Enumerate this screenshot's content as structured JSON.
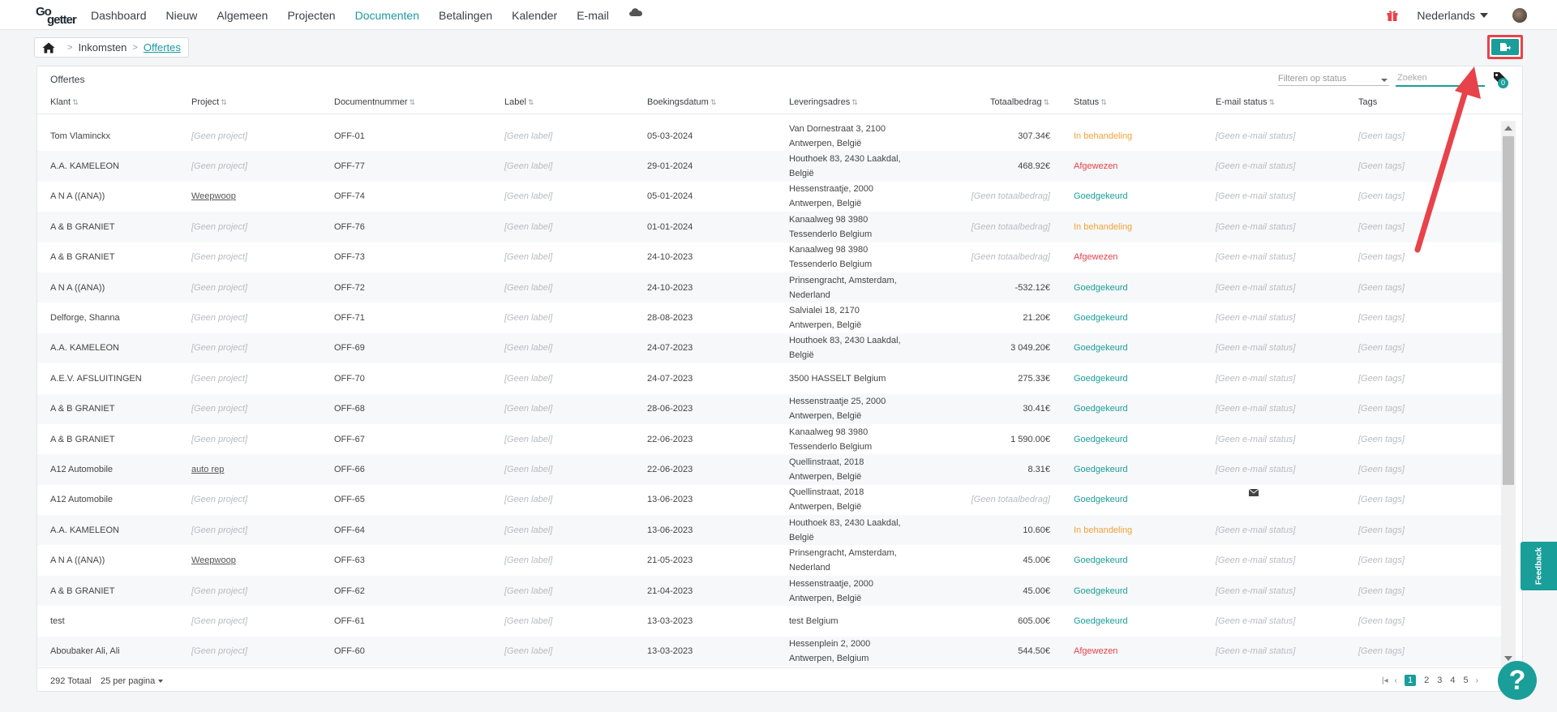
{
  "nav": {
    "logo_top": "Go",
    "logo_bottom": "getter",
    "items": [
      "Dashboard",
      "Nieuw",
      "Algemeen",
      "Projecten",
      "Documenten",
      "Betalingen",
      "Kalender",
      "E-mail"
    ],
    "active": "Documenten",
    "language": "Nederlands",
    "icons": [
      "cloud-icon",
      "gift-icon",
      "avatar"
    ]
  },
  "breadcrumb": {
    "level1": "Inkomsten",
    "level2": "Offertes",
    "icons": [
      "home-icon"
    ]
  },
  "panel": {
    "title": "Offertes",
    "status_filter": "Filteren op status",
    "search_placeholder": "Zoeken",
    "tag_badge": "0"
  },
  "columns": [
    "Klant",
    "Project",
    "Documentnummer",
    "Label",
    "Boekingsdatum",
    "Leveringsadres",
    "Totaalbedrag",
    "Status",
    "E-mail status",
    "Tags"
  ],
  "rows": [
    {
      "klant": "Tom Vlaminckx",
      "project": "[Geen project]",
      "doc": "OFF-01",
      "label": "[Geen label]",
      "date": "05-03-2024",
      "addr1": "Van Dornestraat 3, 2100",
      "addr2": "Antwerpen, België",
      "amount": "307.34€",
      "status": "In behandeling",
      "status_type": "pending",
      "email": "[Geen e-mail status]",
      "tags": "[Geen tags]"
    },
    {
      "klant": "A.A. KAMELEON",
      "project": "[Geen project]",
      "doc": "OFF-77",
      "label": "[Geen label]",
      "date": "29-01-2024",
      "addr1": "Houthoek 83, 2430 Laakdal,",
      "addr2": "België",
      "amount": "468.92€",
      "status": "Afgewezen",
      "status_type": "rejected",
      "email": "[Geen e-mail status]",
      "tags": "[Geen tags]"
    },
    {
      "klant": "A N A ((ANA))",
      "project": "Weepwoop",
      "doc": "OFF-74",
      "label": "[Geen label]",
      "date": "05-01-2024",
      "addr1": "Hessenstraatje, 2000",
      "addr2": "Antwerpen, België",
      "amount": "[Geen totaalbedrag]",
      "status": "Goedgekeurd",
      "status_type": "approved",
      "email": "[Geen e-mail status]",
      "tags": "[Geen tags]"
    },
    {
      "klant": "A & B GRANIET",
      "project": "[Geen project]",
      "doc": "OFF-76",
      "label": "[Geen label]",
      "date": "01-01-2024",
      "addr1": "Kanaalweg 98 3980",
      "addr2": "Tessenderlo Belgium",
      "amount": "[Geen totaalbedrag]",
      "status": "In behandeling",
      "status_type": "pending",
      "email": "[Geen e-mail status]",
      "tags": "[Geen tags]"
    },
    {
      "klant": "A & B GRANIET",
      "project": "[Geen project]",
      "doc": "OFF-73",
      "label": "[Geen label]",
      "date": "24-10-2023",
      "addr1": "Kanaalweg 98 3980",
      "addr2": "Tessenderlo Belgium",
      "amount": "[Geen totaalbedrag]",
      "status": "Afgewezen",
      "status_type": "rejected",
      "email": "[Geen e-mail status]",
      "tags": "[Geen tags]"
    },
    {
      "klant": "A N A ((ANA))",
      "project": "[Geen project]",
      "doc": "OFF-72",
      "label": "[Geen label]",
      "date": "24-10-2023",
      "addr1": "Prinsengracht, Amsterdam,",
      "addr2": "Nederland",
      "amount": "-532.12€",
      "status": "Goedgekeurd",
      "status_type": "approved",
      "email": "[Geen e-mail status]",
      "tags": "[Geen tags]"
    },
    {
      "klant": "Delforge, Shanna",
      "project": "[Geen project]",
      "doc": "OFF-71",
      "label": "[Geen label]",
      "date": "28-08-2023",
      "addr1": "Salvialei 18, 2170",
      "addr2": "Antwerpen, België",
      "amount": "21.20€",
      "status": "Goedgekeurd",
      "status_type": "approved",
      "email": "[Geen e-mail status]",
      "tags": "[Geen tags]"
    },
    {
      "klant": "A.A. KAMELEON",
      "project": "[Geen project]",
      "doc": "OFF-69",
      "label": "[Geen label]",
      "date": "24-07-2023",
      "addr1": "Houthoek 83, 2430 Laakdal,",
      "addr2": "België",
      "amount": "3 049.20€",
      "status": "Goedgekeurd",
      "status_type": "approved",
      "email": "[Geen e-mail status]",
      "tags": "[Geen tags]"
    },
    {
      "klant": "A.E.V. AFSLUITINGEN",
      "project": "[Geen project]",
      "doc": "OFF-70",
      "label": "[Geen label]",
      "date": "24-07-2023",
      "addr1": "3500 HASSELT Belgium",
      "addr2": "",
      "amount": "275.33€",
      "status": "Goedgekeurd",
      "status_type": "approved",
      "email": "[Geen e-mail status]",
      "tags": "[Geen tags]"
    },
    {
      "klant": "A & B GRANIET",
      "project": "[Geen project]",
      "doc": "OFF-68",
      "label": "[Geen label]",
      "date": "28-06-2023",
      "addr1": "Hessenstraatje 25, 2000",
      "addr2": "Antwerpen, België",
      "amount": "30.41€",
      "status": "Goedgekeurd",
      "status_type": "approved",
      "email": "[Geen e-mail status]",
      "tags": "[Geen tags]"
    },
    {
      "klant": "A & B GRANIET",
      "project": "[Geen project]",
      "doc": "OFF-67",
      "label": "[Geen label]",
      "date": "22-06-2023",
      "addr1": "Kanaalweg 98 3980",
      "addr2": "Tessenderlo Belgium",
      "amount": "1 590.00€",
      "status": "Goedgekeurd",
      "status_type": "approved",
      "email": "[Geen e-mail status]",
      "tags": "[Geen tags]"
    },
    {
      "klant": "A12 Automobile",
      "project": "auto rep",
      "doc": "OFF-66",
      "label": "[Geen label]",
      "date": "22-06-2023",
      "addr1": "Quellinstraat, 2018",
      "addr2": "Antwerpen, België",
      "amount": "8.31€",
      "status": "Goedgekeurd",
      "status_type": "approved",
      "email": "[Geen e-mail status]",
      "tags": "[Geen tags]"
    },
    {
      "klant": "A12 Automobile",
      "project": "[Geen project]",
      "doc": "OFF-65",
      "label": "[Geen label]",
      "date": "13-06-2023",
      "addr1": "Quellinstraat, 2018",
      "addr2": "Antwerpen, België",
      "amount": "[Geen totaalbedrag]",
      "status": "Goedgekeurd",
      "status_type": "approved",
      "email": "",
      "email_icon": "mail-icon",
      "tags": "[Geen tags]"
    },
    {
      "klant": "A.A. KAMELEON",
      "project": "[Geen project]",
      "doc": "OFF-64",
      "label": "[Geen label]",
      "date": "13-06-2023",
      "addr1": "Houthoek 83, 2430 Laakdal,",
      "addr2": "België",
      "amount": "10.60€",
      "status": "In behandeling",
      "status_type": "pending",
      "email": "[Geen e-mail status]",
      "tags": "[Geen tags]"
    },
    {
      "klant": "A N A ((ANA))",
      "project": "Weepwoop",
      "doc": "OFF-63",
      "label": "[Geen label]",
      "date": "21-05-2023",
      "addr1": "Prinsengracht, Amsterdam,",
      "addr2": "Nederland",
      "amount": "45.00€",
      "status": "Goedgekeurd",
      "status_type": "approved",
      "email": "[Geen e-mail status]",
      "tags": "[Geen tags]"
    },
    {
      "klant": "A & B GRANIET",
      "project": "[Geen project]",
      "doc": "OFF-62",
      "label": "[Geen label]",
      "date": "21-04-2023",
      "addr1": "Hessenstraatje, 2000",
      "addr2": "Antwerpen, België",
      "amount": "45.00€",
      "status": "Goedgekeurd",
      "status_type": "approved",
      "email": "[Geen e-mail status]",
      "tags": "[Geen tags]"
    },
    {
      "klant": "test",
      "project": "[Geen project]",
      "doc": "OFF-61",
      "label": "[Geen label]",
      "date": "13-03-2023",
      "addr1": "test Belgium",
      "addr2": "",
      "amount": "605.00€",
      "status": "Goedgekeurd",
      "status_type": "approved",
      "email": "[Geen e-mail status]",
      "tags": "[Geen tags]"
    },
    {
      "klant": "Aboubaker Ali, Ali",
      "project": "[Geen project]",
      "doc": "OFF-60",
      "label": "[Geen label]",
      "date": "13-03-2023",
      "addr1": "Hessenplein 2, 2000",
      "addr2": "Antwerpen, Belgium",
      "amount": "544.50€",
      "status": "Afgewezen",
      "status_type": "rejected",
      "email": "[Geen e-mail status]",
      "tags": "[Geen tags]"
    }
  ],
  "footer": {
    "total": "292 Totaal",
    "per_page": "25 per pagina",
    "pages": [
      "1",
      "2",
      "3",
      "4",
      "5"
    ],
    "active_page": "1"
  },
  "feedback_label": "Feedback",
  "help_label": "?",
  "colors": {
    "accent": "#1a9e9a",
    "pending": "#f0a23a",
    "rejected": "#e6404a",
    "annotation": "#e8424a"
  }
}
